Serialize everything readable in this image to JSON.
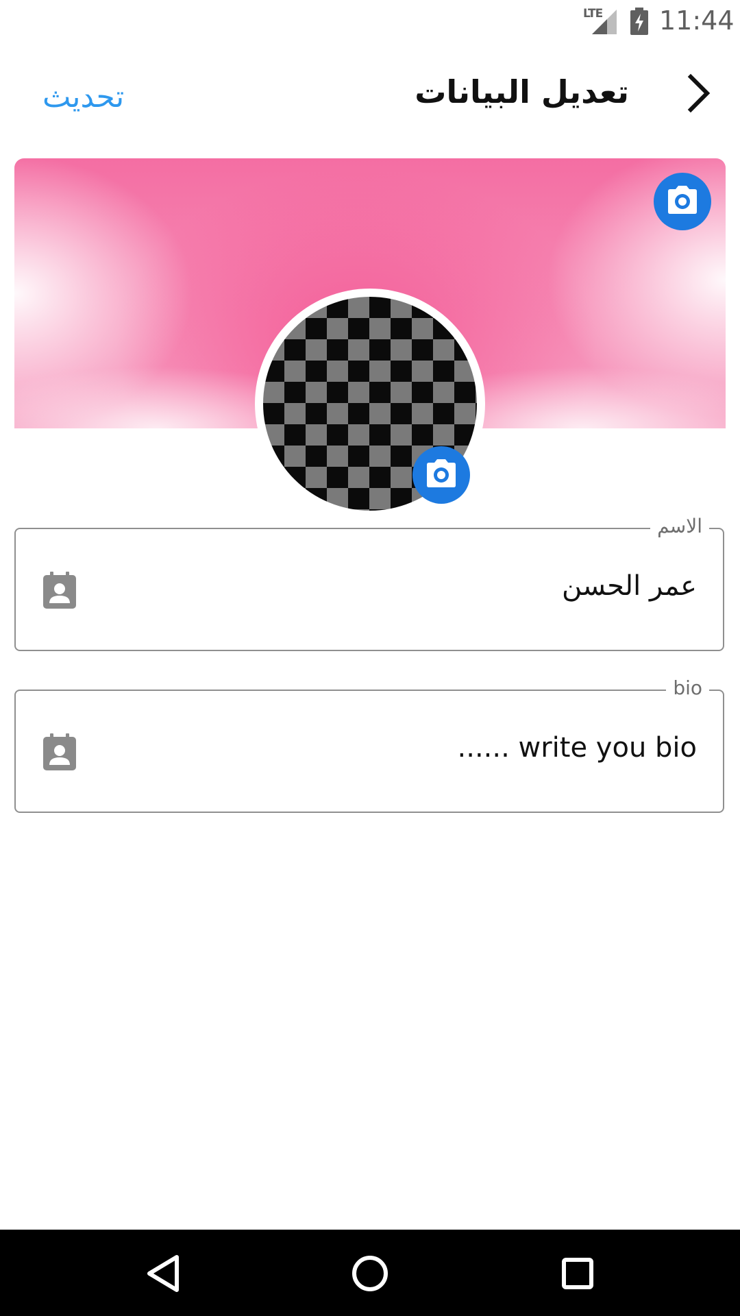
{
  "status_bar": {
    "network": "LTE",
    "time": "11:44"
  },
  "header": {
    "title": "تعديل البيانات",
    "update_label": "تحديث"
  },
  "fields": {
    "name": {
      "label": "الاسم",
      "value": "عمر الحسن"
    },
    "bio": {
      "label": "bio",
      "value": "...... write you bio"
    }
  },
  "icons": {
    "back": "chevron-right-icon",
    "cover_camera": "camera-icon",
    "avatar_camera": "camera-icon",
    "field_icon": "contact-card-icon",
    "nav_back": "triangle-back-icon",
    "nav_home": "circle-home-icon",
    "nav_recent": "square-recents-icon"
  },
  "colors": {
    "accent": "#2e98ee",
    "camera_button": "#1d7ae0",
    "cover_pink": "#f46ea3",
    "field_border": "#8f8f8f",
    "nav_bar": "#000000"
  }
}
